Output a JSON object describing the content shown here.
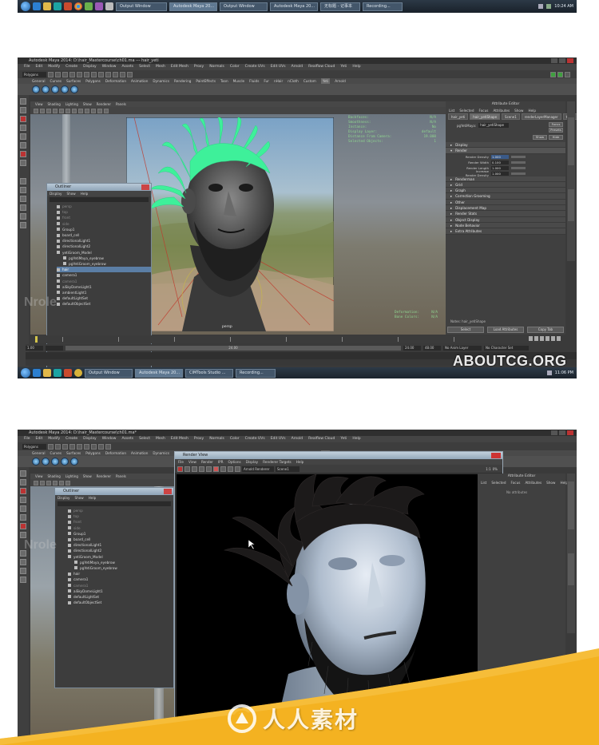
{
  "top_taskbar": {
    "buttons": [
      "Output Window",
      "Autodesk Maya 20...",
      "Output Window",
      "Autodesk Maya 20...",
      "无标题 - 记事本",
      "Recording..."
    ],
    "clock": "10:24 AM"
  },
  "screen1": {
    "window_title": "Autodesk Maya 2014: D:\\hair_Mastercourse\\ch01.ma  ---  hair_yeti",
    "menus": [
      "File",
      "Edit",
      "Modify",
      "Create",
      "Display",
      "Window",
      "Assets",
      "Select",
      "Mesh",
      "Edit Mesh",
      "Proxy",
      "Normals",
      "Color",
      "Create UVs",
      "Edit UVs",
      "Arnold",
      "Realflow Cloud",
      "Yeti",
      "Help"
    ],
    "mode_dropdown": "Polygons",
    "shelf_tabs": [
      "General",
      "Curves",
      "Surfaces",
      "Polygons",
      "Deformation",
      "Animation",
      "Dynamics",
      "Rendering",
      "PaintEffects",
      "Toon",
      "Muscle",
      "Fluids",
      "Fur",
      "nHair",
      "nCloth",
      "Custom",
      "Yeti",
      "Arnold"
    ],
    "viewport_menus": [
      "View",
      "Shading",
      "Lighting",
      "Show",
      "Renderer",
      "Panels"
    ],
    "hud_top": [
      [
        "Backfaces:",
        "N/A"
      ],
      [
        "Smoothness:",
        "N/A"
      ],
      [
        "Instance:",
        "No"
      ],
      [
        "Display Layer:",
        "default"
      ],
      [
        "Distance From Camera:",
        "19.000"
      ],
      [
        "Selected Objects:",
        "1"
      ]
    ],
    "hud_bottom": [
      [
        "Deformation:",
        "N/A"
      ],
      [
        "Bone Colors:",
        "N/A"
      ]
    ],
    "camera_label": "persp",
    "outliner": {
      "title": "Outliner",
      "menus": [
        "Display",
        "Show",
        "Help"
      ],
      "items": [
        {
          "label": "persp",
          "state": "dim"
        },
        {
          "label": "top",
          "state": "dim"
        },
        {
          "label": "front",
          "state": "dim"
        },
        {
          "label": "side",
          "state": "dim"
        },
        {
          "label": "Group1",
          "state": "normal"
        },
        {
          "label": "board_cell",
          "state": "normal"
        },
        {
          "label": "directionalLight1",
          "state": "normal"
        },
        {
          "label": "directionalLight2",
          "state": "normal"
        },
        {
          "label": "yetiGroom_Model",
          "state": "normal"
        },
        {
          "label": "pgYetiMaya_eyebrow",
          "state": "normal"
        },
        {
          "label": "pgYetiGroom_eyebrow",
          "state": "normal"
        },
        {
          "label": "hair",
          "state": "selected"
        },
        {
          "label": "camera1",
          "state": "normal"
        },
        {
          "label": "camera1",
          "state": "dim"
        },
        {
          "label": "aiSkyDomeLight1",
          "state": "normal"
        },
        {
          "label": "ambientLight1",
          "state": "normal"
        },
        {
          "label": "defaultLightSet",
          "state": "normal"
        },
        {
          "label": "defaultObjectSet",
          "state": "normal"
        }
      ]
    },
    "attribute_editor": {
      "title": "Attribute Editor",
      "menus": [
        "List",
        "Selected",
        "Focus",
        "Attributes",
        "Show",
        "Help"
      ],
      "tabs": [
        "hair_yeti",
        "hair_yetiShape",
        "Scene1",
        "renderLayerManager",
        "time1"
      ],
      "node_label": "pgYetiMaya:",
      "node_value": "hair_yetiShape",
      "buttons": [
        "Focus",
        "Presets",
        "Show",
        "Hide"
      ],
      "sections": [
        {
          "label": "Display",
          "open": false
        },
        {
          "label": "Render",
          "open": true
        },
        {
          "label": "Renderman",
          "open": false
        },
        {
          "label": "Grid",
          "open": false
        },
        {
          "label": "Graph",
          "open": false
        },
        {
          "label": "Correction Grooming",
          "open": false
        },
        {
          "label": "Other",
          "open": false
        },
        {
          "label": "Displacement Map",
          "open": false
        },
        {
          "label": "Render Stats",
          "open": false
        },
        {
          "label": "Object Display",
          "open": false
        },
        {
          "label": "Node Behavior",
          "open": false
        },
        {
          "label": "Extra Attributes",
          "open": false
        }
      ],
      "render_attrs": [
        {
          "label": "Render Density",
          "value": "1.000"
        },
        {
          "label": "Render Width",
          "value": "0.100"
        },
        {
          "label": "Render Length",
          "value": "1.000"
        },
        {
          "label": "Increase Render Density",
          "value": "1.000"
        }
      ],
      "notes_label": "Notes: hair_yetiShape",
      "bottom_buttons": [
        "Select",
        "Load Attributes",
        "Copy Tab"
      ]
    },
    "range": {
      "start": "1.00",
      "end": "24.00",
      "end2": "48.00",
      "anim_layer": "No Anim Layer",
      "char_set": "No Character Set"
    },
    "watermark_left": "Nrole",
    "watermark_logo": "ABOUTCG.ORG",
    "taskbar": {
      "buttons": [
        "Output Window",
        "Autodesk Maya 20...",
        "CIMTools Studio ...",
        "Recording..."
      ],
      "clock": "11:06 PM"
    }
  },
  "screen2": {
    "window_title": "Autodesk Maya 2014: D:\\hair_Mastercourse\\ch01.ma*",
    "menus": [
      "File",
      "Edit",
      "Modify",
      "Create",
      "Display",
      "Window",
      "Assets",
      "Select",
      "Mesh",
      "Edit Mesh",
      "Proxy",
      "Normals",
      "Color",
      "Create UVs",
      "Edit UVs",
      "Arnold",
      "Realflow Cloud",
      "Yeti",
      "Help"
    ],
    "mode_dropdown": "Polygons",
    "shelf_tabs": [
      "General",
      "Curves",
      "Surfaces",
      "Polygons",
      "Deformation",
      "Animation",
      "Dynamics",
      "Rendering",
      "PaintEffects",
      "Toon",
      "Muscle",
      "Fluids",
      "Fur",
      "nHair",
      "nCloth",
      "Custom",
      "Yeti",
      "Arnold"
    ],
    "viewport_menus": [
      "View",
      "Shading",
      "Lighting",
      "Show",
      "Renderer",
      "Panels"
    ],
    "outliner": {
      "title": "Outliner",
      "menus": [
        "Display",
        "Show",
        "Help"
      ],
      "items": [
        {
          "label": "persp",
          "state": "dim"
        },
        {
          "label": "top",
          "state": "dim"
        },
        {
          "label": "front",
          "state": "dim"
        },
        {
          "label": "side",
          "state": "dim"
        },
        {
          "label": "Group1",
          "state": "normal"
        },
        {
          "label": "board_cell",
          "state": "normal"
        },
        {
          "label": "directionalLight1",
          "state": "normal"
        },
        {
          "label": "directionalLight2",
          "state": "normal"
        },
        {
          "label": "yetiGroom_Model",
          "state": "normal"
        },
        {
          "label": "pgYetiMaya_eyebrow",
          "state": "normal"
        },
        {
          "label": "pgYetiGroom_eyebrow",
          "state": "normal"
        },
        {
          "label": "hair",
          "state": "normal"
        },
        {
          "label": "camera1",
          "state": "normal"
        },
        {
          "label": "camera1",
          "state": "dim"
        },
        {
          "label": "aiSkyDomeLight1",
          "state": "normal"
        },
        {
          "label": "defaultLightSet",
          "state": "normal"
        },
        {
          "label": "defaultObjectSet",
          "state": "normal"
        }
      ]
    },
    "render_view": {
      "title": "Render View",
      "menus": [
        "File",
        "View",
        "Render",
        "IPR",
        "Options",
        "Display",
        "Renderer Targets",
        "Help"
      ],
      "renderer": "Arnold Renderer",
      "camera": "Scene1",
      "ratio": "1:1",
      "zoom": "0%"
    },
    "attribute_editor": {
      "title": "Attribute Editor",
      "menus": [
        "List",
        "Selected",
        "Focus",
        "Attributes",
        "Show",
        "Help"
      ],
      "note": "No attributes"
    },
    "watermark_left": "Nrole",
    "brand_logo": "人人素材",
    "colors": {
      "promo_yellow": "#f4b221",
      "hair_green": "#3ef09a"
    }
  }
}
